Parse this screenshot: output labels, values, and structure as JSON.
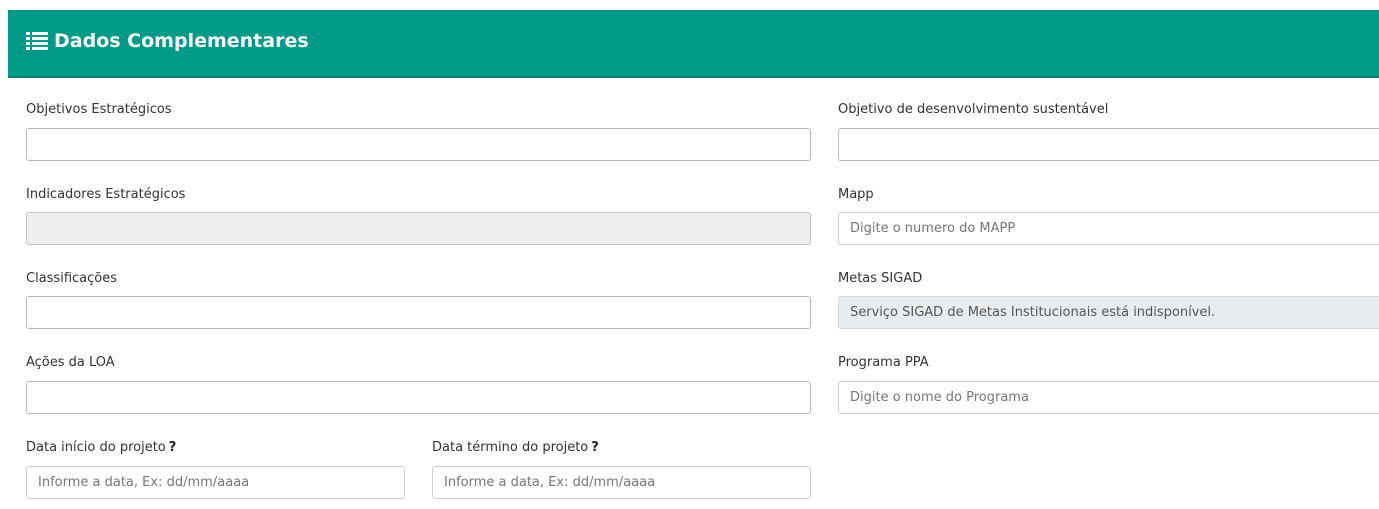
{
  "header": {
    "title": "Dados Complementares",
    "icon": "list-icon",
    "background_color": "#009a88"
  },
  "fields": {
    "objetivos_estrategicos": {
      "label": "Objetivos Estratégicos",
      "value": ""
    },
    "objetivo_desenvolvimento": {
      "label": "Objetivo de desenvolvimento sustentável",
      "value": ""
    },
    "indicadores_estrategicos": {
      "label": "Indicadores Estratégicos",
      "value": ""
    },
    "mapp": {
      "label": "Mapp",
      "placeholder": "Digite o numero do MAPP"
    },
    "classificacoes": {
      "label": "Classificações",
      "value": ""
    },
    "metas_sigad": {
      "label": "Metas SIGAD",
      "value": "Serviço SIGAD de Metas Institucionais está indisponível."
    },
    "acoes_loa": {
      "label": "Ações da LOA",
      "value": ""
    },
    "programa_ppa": {
      "label": "Programa PPA",
      "placeholder": "Digite o nome do Programa"
    },
    "data_inicio": {
      "label": "Data início do projeto",
      "help": "?",
      "placeholder": "Informe a data, Ex: dd/mm/aaaa"
    },
    "data_termino": {
      "label": "Data término do projeto",
      "help": "?",
      "placeholder": "Informe a data, Ex: dd/mm/aaaa"
    }
  }
}
